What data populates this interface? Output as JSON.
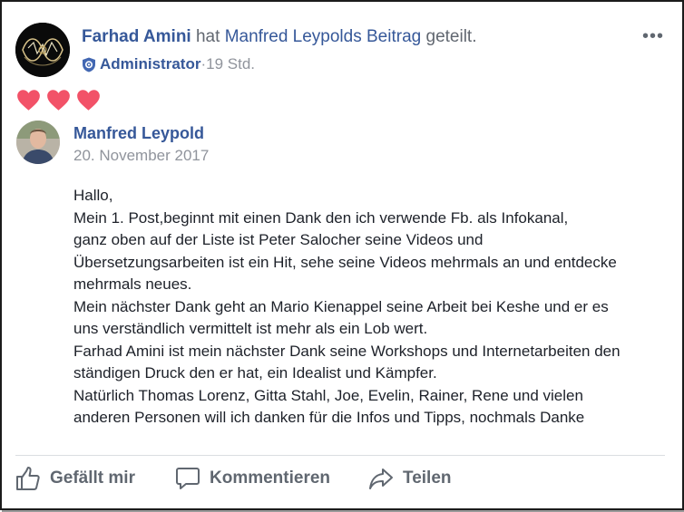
{
  "post": {
    "author": "Farhad Amini",
    "action_text_1": " hat ",
    "shared_from": "Manfred Leypold",
    "shared_from_suffix": "s Beitrag",
    "action_text_2": " geteilt.",
    "role": "Administrator",
    "separator": " · ",
    "time": "19 Std.",
    "more_label": "•••",
    "reactions": [
      "heart",
      "heart",
      "heart"
    ]
  },
  "shared": {
    "author": "Manfred Leypold",
    "date": "20. November 2017",
    "lines": [
      "Hallo,",
      "Mein 1. Post,beginnt mit einen Dank den ich verwende Fb. als Infokanal,",
      "ganz oben auf der Liste ist Peter Salocher seine Videos und",
      "Übersetzungsarbeiten ist ein Hit, sehe seine Videos mehrmals an und entdecke",
      "mehrmals neues.",
      "Mein nächster Dank geht an Mario Kienappel seine Arbeit bei Keshe und er es",
      "uns verständlich vermittelt ist mehr als ein Lob wert.",
      "Farhad Amini ist mein nächster Dank seine Workshops und Internetarbeiten den",
      "ständigen Druck den er hat, ein Idealist und Kämpfer.",
      "Natürlich Thomas Lorenz, Gitta Stahl, Joe, Evelin, Rainer, Rene und vielen",
      "anderen Personen will ich danken für die Infos und Tipps, nochmals Danke"
    ]
  },
  "actions": {
    "like": "Gefällt mir",
    "comment": "Kommentieren",
    "share": "Teilen"
  },
  "colors": {
    "link": "#365899",
    "meta": "#90949c",
    "heart": "#f25268",
    "action": "#606770"
  }
}
